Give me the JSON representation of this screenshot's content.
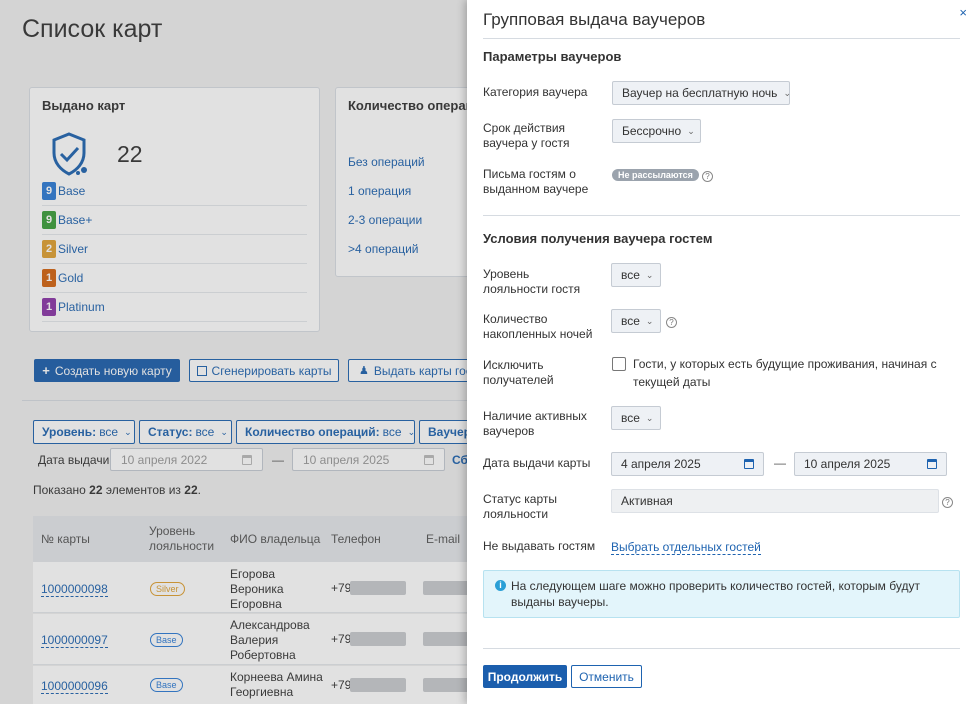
{
  "page": {
    "title": "Список карт"
  },
  "issued": {
    "title": "Выдано карт",
    "total": "22",
    "tiers": [
      {
        "label": "Base",
        "count": "9",
        "color": "#2b7bd6"
      },
      {
        "label": "Base+",
        "count": "9",
        "color": "#3a9e3a"
      },
      {
        "label": "Silver",
        "count": "2",
        "color": "#e0a030"
      },
      {
        "label": "Gold",
        "count": "1",
        "color": "#d4630f"
      },
      {
        "label": "Platinum",
        "count": "1",
        "color": "#8a35a8"
      }
    ]
  },
  "operations": {
    "title": "Количество операций",
    "rows": [
      "Без операций",
      "1 операция",
      "2-3 операции",
      ">4 операций"
    ]
  },
  "actions": {
    "create": "Создать новую карту",
    "generate": "Сгенерировать карты",
    "issue": "Выдать карты гостям"
  },
  "filters": {
    "level_label": "Уровень:",
    "level_value": "все",
    "status_label": "Статус:",
    "status_value": "все",
    "ops_label": "Количество операций:",
    "ops_value": "все",
    "voucher_label": "Ваучеры",
    "date_label": "Дата выдачи:",
    "date_from": "10 апреля 2022",
    "date_to": "10 апреля 2025",
    "reset": "Сбросить",
    "dash": "—"
  },
  "summary": {
    "prefix": "Показано",
    "shown": "22",
    "middle": "элементов из",
    "total": "22",
    "suffix": "."
  },
  "table": {
    "headers": [
      "№ карты",
      "Уровень лояльности",
      "ФИО владельца",
      "Телефон",
      "E-mail"
    ],
    "rows": [
      {
        "card": "1000000098",
        "level": "Silver",
        "level_color": "#e0a030",
        "fio": [
          "Егорова",
          "Вероника",
          "Егоровна"
        ],
        "phone": "+79"
      },
      {
        "card": "1000000097",
        "level": "Base",
        "level_color": "#2b7bd6",
        "fio": [
          "Александрова",
          "Валерия",
          "Робертовна"
        ],
        "phone": "+79"
      },
      {
        "card": "1000000096",
        "level": "Base",
        "level_color": "#2b7bd6",
        "fio": [
          "Корнеева Амина",
          "Георгиевна"
        ],
        "phone": "+79"
      }
    ]
  },
  "panel": {
    "title": "Групповая выдача ваучеров",
    "section1": "Параметры ваучеров",
    "category_label": "Категория ваучера",
    "category_value": "Ваучер на бесплатную ночь",
    "validity_label": "Срок действия ваучера у гостя",
    "validity_value": "Бессрочно",
    "letters_label": "Письма гостям о выданном ваучере",
    "letters_value": "Не рассылаются",
    "section2": "Условия получения ваучера гостем",
    "level_label": "Уровень лояльности гостя",
    "level_value": "все",
    "nights_label": "Количество накопленных ночей",
    "nights_value": "все",
    "exclude_label": "Исключить получателей",
    "exclude_text": "Гости, у которых есть будущие проживания, начиная с текущей даты",
    "active_label": "Наличие активных ваучеров",
    "active_value": "все",
    "date_label": "Дата выдачи карты",
    "date_from": "4 апреля 2025",
    "date_to": "10 апреля 2025",
    "dash": "—",
    "status_label": "Статус карты лояльности",
    "status_value": "Активная",
    "nogive_label": "Не выдавать гостям",
    "nogive_link": "Выбрать отдельных гостей",
    "info": "На следующем шаге можно проверить количество гостей, которым будут выданы ваучеры.",
    "continue": "Продолжить",
    "cancel": "Отменить"
  }
}
